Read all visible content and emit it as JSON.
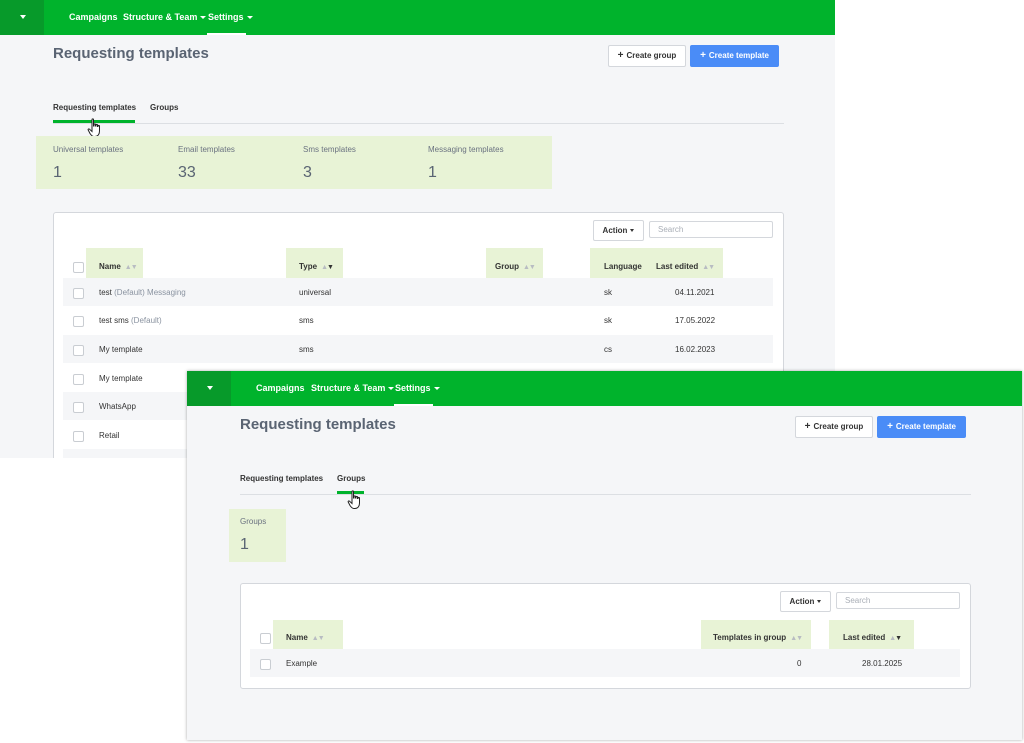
{
  "nav": {
    "items": [
      "Campaigns",
      "Structure & Team",
      "Settings"
    ]
  },
  "page": {
    "title": "Requesting templates",
    "create_group": "Create group",
    "create_template": "Create template"
  },
  "tabs": [
    "Requesting templates",
    "Groups"
  ],
  "templates_view": {
    "stats": [
      {
        "label": "Universal templates",
        "value": "1"
      },
      {
        "label": "Email templates",
        "value": "33"
      },
      {
        "label": "Sms templates",
        "value": "3"
      },
      {
        "label": "Messaging templates",
        "value": "1"
      }
    ],
    "action_label": "Action",
    "search_placeholder": "Search",
    "columns": [
      "Name",
      "Type",
      "Group",
      "Language",
      "Last edited"
    ],
    "rows": [
      {
        "name": "test",
        "tag": "(Default) Messaging",
        "type": "universal",
        "group": "",
        "language": "sk",
        "last_edited": "04.11.2021"
      },
      {
        "name": "test sms",
        "tag": "(Default)",
        "type": "sms",
        "group": "",
        "language": "sk",
        "last_edited": "17.05.2022"
      },
      {
        "name": "My template",
        "tag": "",
        "type": "sms",
        "group": "",
        "language": "cs",
        "last_edited": "16.02.2023"
      },
      {
        "name": "My template",
        "tag": "",
        "type": "",
        "group": "",
        "language": "",
        "last_edited": ""
      },
      {
        "name": "WhatsApp",
        "tag": "",
        "type": "",
        "group": "",
        "language": "",
        "last_edited": ""
      },
      {
        "name": "Retail",
        "tag": "",
        "type": "",
        "group": "",
        "language": "",
        "last_edited": ""
      }
    ]
  },
  "groups_view": {
    "stat": {
      "label": "Groups",
      "value": "1"
    },
    "action_label": "Action",
    "search_placeholder": "Search",
    "columns": [
      "Name",
      "Templates in group",
      "Last edited"
    ],
    "rows": [
      {
        "name": "Example",
        "templates_in_group": "0",
        "last_edited": "28.01.2025"
      }
    ]
  },
  "icons": {
    "menu": "caret-down-icon",
    "cursor": "hand-pointer-icon",
    "sort": "sort-arrows-icon"
  },
  "colors": {
    "brand_green": "#00b32c",
    "primary_blue": "#4a8cf7",
    "highlight": "#e8f3d6"
  }
}
